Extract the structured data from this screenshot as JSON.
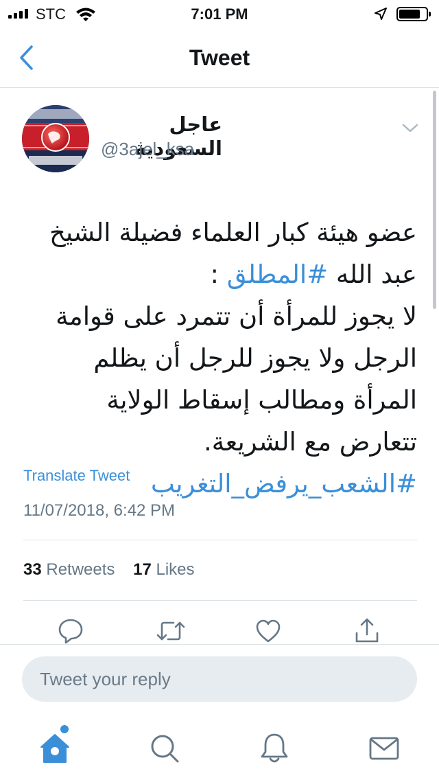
{
  "status_bar": {
    "carrier": "STC",
    "time": "7:01 PM"
  },
  "nav": {
    "title": "Tweet"
  },
  "tweet": {
    "author_name": "عاجل السعودية",
    "handle": "@3ajel_ksa",
    "text_before_mention": "عضو هيئة كبار العلماء فضيلة الشيخ عبد الله ",
    "mention_hashtag": "#المطلق",
    "text_after_mention": " :\nلا يجوز للمرأة أن تتمرد على قوامة الرجل ولا يجوز للرجل أن يظلم المرأة ومطالب إسقاط الولاية تتعارض مع الشريعة.\n",
    "trailing_hashtag": "#الشعب_يرفض_التغريب",
    "translate_label": "Translate Tweet",
    "timestamp": "11/07/2018, 6:42 PM",
    "retweets_count": "33",
    "retweets_label": "Retweets",
    "likes_count": "17",
    "likes_label": "Likes"
  },
  "reply": {
    "placeholder": "Tweet your reply"
  },
  "icons": {
    "back": "chevron-left-icon",
    "caret": "chevron-down-icon",
    "reply": "reply-icon",
    "retweet": "retweet-icon",
    "like": "heart-icon",
    "share": "share-icon",
    "home": "home-icon",
    "search": "search-icon",
    "notifications": "bell-icon",
    "messages": "mail-icon"
  },
  "colors": {
    "accent": "#3b8fd9",
    "secondary_text": "#657786",
    "divider": "#dde2e6",
    "reply_bg": "#e6ecf0"
  }
}
